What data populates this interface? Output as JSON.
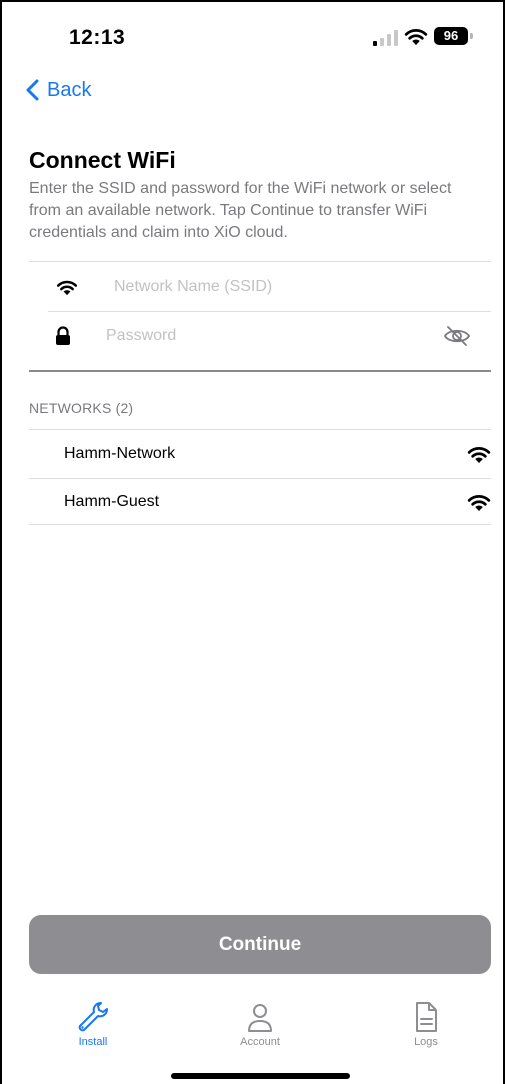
{
  "status_bar": {
    "time": "12:13",
    "battery": "96"
  },
  "nav": {
    "back_label": "Back"
  },
  "header": {
    "title": "Connect WiFi",
    "description": "Enter the SSID and password for the WiFi network or select from an available network.  Tap Continue to transfer WiFi credentials and claim into XiO cloud."
  },
  "form": {
    "ssid": {
      "placeholder": "Network Name (SSID)",
      "value": ""
    },
    "password": {
      "placeholder": "Password",
      "value": ""
    }
  },
  "networks": {
    "header": "NETWORKS (2)",
    "items": [
      {
        "name": "Hamm-Network"
      },
      {
        "name": "Hamm-Guest"
      }
    ]
  },
  "continue_label": "Continue",
  "tabs": [
    {
      "label": "Install",
      "active": true
    },
    {
      "label": "Account",
      "active": false
    },
    {
      "label": "Logs",
      "active": false
    }
  ],
  "colors": {
    "accent": "#1778f2",
    "inactive": "#8e8e92",
    "button_bg": "#8e8e92"
  },
  "icons": {
    "status": [
      "signal-icon",
      "wifi-icon",
      "battery-icon"
    ],
    "ssid_field": "wifi-icon",
    "password_field": "lock-icon",
    "password_toggle": "eye-slash-icon",
    "network_row": "wifi-icon",
    "tabs": [
      "wrench-icon",
      "person-icon",
      "document-icon"
    ]
  }
}
